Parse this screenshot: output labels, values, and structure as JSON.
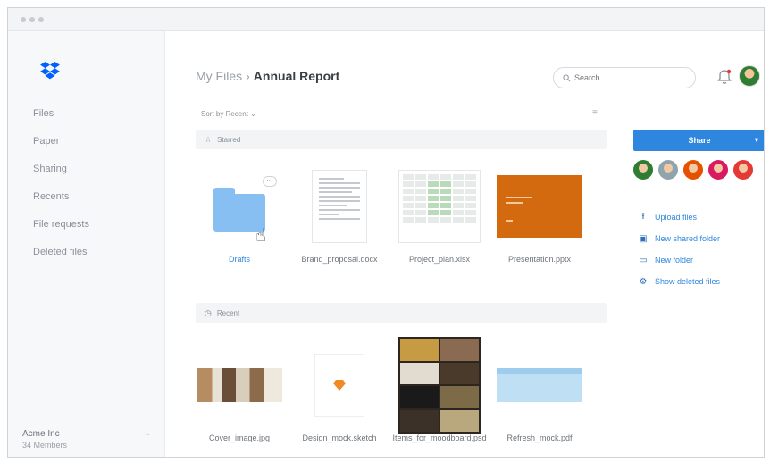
{
  "sidebar": {
    "nav": [
      {
        "label": "Files",
        "icon": "files-icon"
      },
      {
        "label": "Paper",
        "icon": "paper-icon"
      },
      {
        "label": "Sharing",
        "icon": "sharing-icon"
      },
      {
        "label": "Recents",
        "icon": "recents-icon"
      },
      {
        "label": "File requests",
        "icon": "file-requests-icon"
      },
      {
        "label": "Deleted files",
        "icon": "deleted-files-icon"
      }
    ],
    "team_name": "Acme Inc",
    "team_members": "34 Members"
  },
  "header": {
    "breadcrumb_root": "My Files",
    "breadcrumb_sep": "›",
    "breadcrumb_current": "Annual Report",
    "search_placeholder": "Search"
  },
  "toolbar": {
    "sort_label": "Sort by Recent ⌄",
    "view_toggle": "≡"
  },
  "sections": [
    {
      "label": "Starred"
    },
    {
      "label": "Recent"
    }
  ],
  "starred": [
    {
      "name": "Drafts",
      "kind": "folder"
    },
    {
      "name": "Brand_proposal.docx",
      "kind": "document"
    },
    {
      "name": "Project_plan.xlsx",
      "kind": "spreadsheet"
    },
    {
      "name": "Presentation.pptx",
      "kind": "presentation"
    }
  ],
  "recent": [
    {
      "name": "Cover_image.jpg",
      "kind": "image"
    },
    {
      "name": "Design_mock.sketch",
      "kind": "sketch"
    },
    {
      "name": "Items_for_moodboard.psd",
      "kind": "moodboard"
    },
    {
      "name": "Refresh_mock.pdf",
      "kind": "mockup"
    }
  ],
  "right_panel": {
    "share_label": "Share",
    "actions": [
      {
        "label": "Upload files",
        "icon": "upload-icon"
      },
      {
        "label": "New shared folder",
        "icon": "shared-folder-icon"
      },
      {
        "label": "New folder",
        "icon": "new-folder-icon"
      },
      {
        "label": "Show deleted files",
        "icon": "show-deleted-icon"
      }
    ],
    "avatar_colors": [
      "#2e7d32",
      "#90a4ae",
      "#e65100",
      "#d81b60",
      "#e53935"
    ]
  },
  "colors": {
    "accent": "#2e86de",
    "folder": "#88bff2",
    "presentation": "#d46a0f"
  }
}
